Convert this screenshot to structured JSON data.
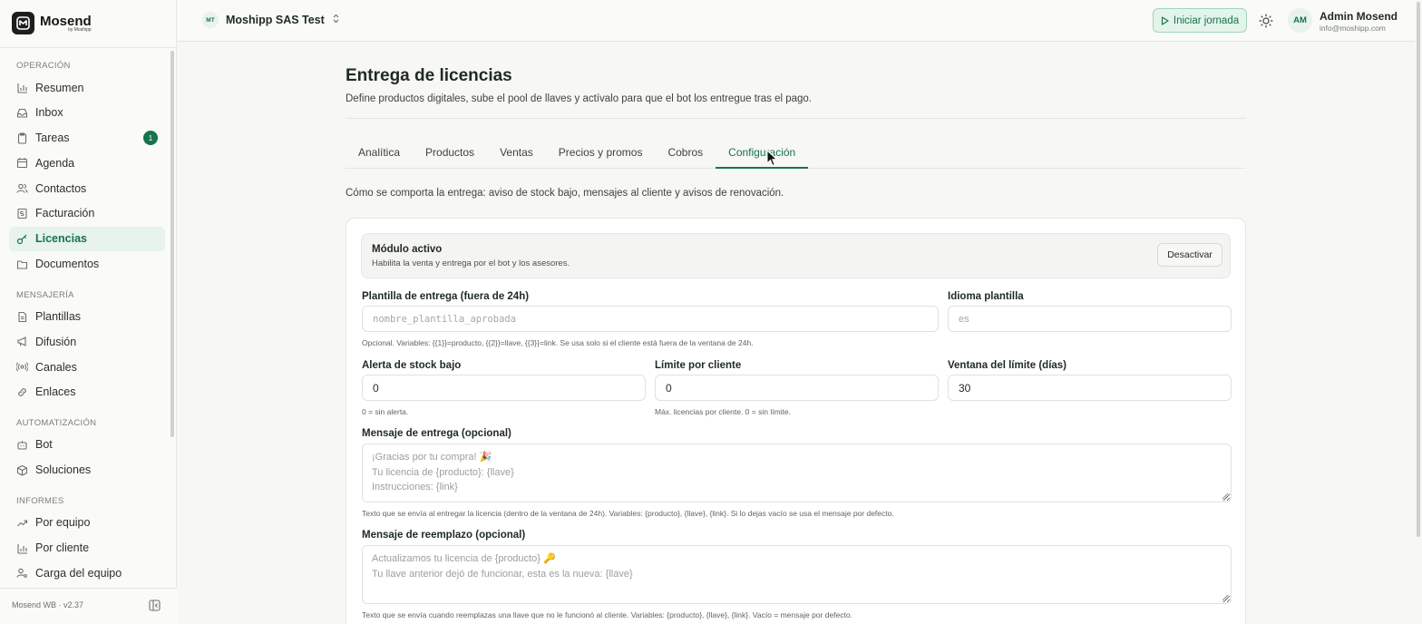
{
  "brand": {
    "name": "Mosend",
    "subtitle": "by Moshipp"
  },
  "sidebar": {
    "sections": [
      {
        "label": "OPERACIÓN",
        "items": [
          {
            "label": "Resumen",
            "icon": "bar-chart-icon"
          },
          {
            "label": "Inbox",
            "icon": "inbox-icon"
          },
          {
            "label": "Tareas",
            "icon": "clipboard-icon",
            "badge": "1"
          },
          {
            "label": "Agenda",
            "icon": "calendar-icon"
          },
          {
            "label": "Contactos",
            "icon": "users-icon"
          },
          {
            "label": "Facturación",
            "icon": "receipt-icon"
          },
          {
            "label": "Licencias",
            "icon": "key-icon",
            "active": true
          },
          {
            "label": "Documentos",
            "icon": "folder-icon"
          }
        ]
      },
      {
        "label": "MENSAJERÍA",
        "items": [
          {
            "label": "Plantillas",
            "icon": "file-text-icon"
          },
          {
            "label": "Difusión",
            "icon": "megaphone-icon"
          },
          {
            "label": "Canales",
            "icon": "radio-icon"
          },
          {
            "label": "Enlaces",
            "icon": "link-icon"
          }
        ]
      },
      {
        "label": "AUTOMATIZACIÓN",
        "items": [
          {
            "label": "Bot",
            "icon": "bot-icon"
          },
          {
            "label": "Soluciones",
            "icon": "box-icon"
          }
        ]
      },
      {
        "label": "INFORMES",
        "items": [
          {
            "label": "Por equipo",
            "icon": "trend-icon"
          },
          {
            "label": "Por cliente",
            "icon": "bar-chart-icon"
          },
          {
            "label": "Carga del equipo",
            "icon": "user-cog-icon"
          }
        ]
      }
    ],
    "version": "Mosend WB · v2.37"
  },
  "header": {
    "workspace_initials": "MT",
    "workspace_name": "Moshipp SAS Test",
    "start_button": "Iniciar jornada",
    "user_initials": "AM",
    "user_name": "Admin Mosend",
    "user_email": "info@moshipp.com"
  },
  "page": {
    "title": "Entrega de licencias",
    "subtitle": "Define productos digitales, sube el pool de llaves y actívalo para que el bot los entregue tras el pago.",
    "tabs": [
      "Analítica",
      "Productos",
      "Ventas",
      "Precios y promos",
      "Cobros",
      "Configuración"
    ],
    "active_tab": "Configuración",
    "description": "Cómo se comporta la entrega: aviso de stock bajo, mensajes al cliente y avisos de renovación."
  },
  "module": {
    "title": "Módulo activo",
    "subtitle": "Habilita la venta y entrega por el bot y los asesores.",
    "button": "Desactivar"
  },
  "form": {
    "template": {
      "label": "Plantilla de entrega (fuera de 24h)",
      "placeholder": "nombre_plantilla_aprobada",
      "value": "",
      "help": "Opcional. Variables: {{1}}=producto, {{2}}=llave, {{3}}=link. Se usa solo si el cliente está fuera de la ventana de 24h."
    },
    "language": {
      "label": "Idioma plantilla",
      "placeholder": "es",
      "value": ""
    },
    "stock_alert": {
      "label": "Alerta de stock bajo",
      "value": "0",
      "help": "0 = sin alerta."
    },
    "client_limit": {
      "label": "Límite por cliente",
      "value": "0",
      "help": "Máx. licencias por cliente. 0 = sin límite."
    },
    "limit_window": {
      "label": "Ventana del límite (días)",
      "value": "30"
    },
    "delivery_message": {
      "label": "Mensaje de entrega (opcional)",
      "placeholder_lines": [
        "¡Gracias por tu compra! 🎉",
        "Tu licencia de {producto}: {llave}",
        "Instrucciones: {link}"
      ],
      "help": "Texto que se envía al entregar la licencia (dentro de la ventana de 24h). Variables: {producto}, {llave}, {link}. Si lo dejas vacío se usa el mensaje por defecto."
    },
    "replacement_message": {
      "label": "Mensaje de reemplazo (opcional)",
      "placeholder_lines": [
        "Actualizamos tu licencia de {producto} 🔑",
        "Tu llave anterior dejó de funcionar, esta es la nueva: {llave}"
      ],
      "help": "Texto que se envía cuando reemplazas una llave que no le funcionó al cliente. Variables: {producto}, {llave}, {link}. Vacío = mensaje por defecto."
    }
  },
  "colors": {
    "accent": "#17734d",
    "accent_bg": "#e7f3ec",
    "border": "#e6e6e3"
  }
}
